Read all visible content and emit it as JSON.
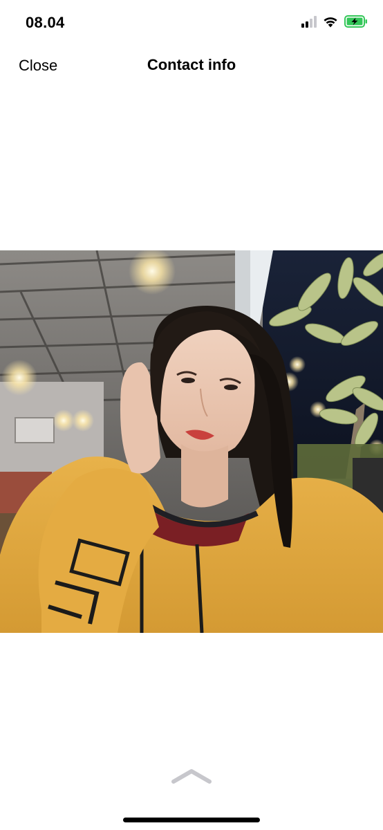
{
  "status_bar": {
    "time": "08.04",
    "icons": [
      "signal-icon",
      "wifi-icon",
      "battery-charging-icon"
    ],
    "battery_color": "#34c759"
  },
  "nav": {
    "close_label": "Close",
    "title": "Contact info"
  },
  "photo": {
    "description_icon": "profile-photo"
  },
  "bottom": {
    "icons": [
      "chevron-up-icon"
    ]
  }
}
